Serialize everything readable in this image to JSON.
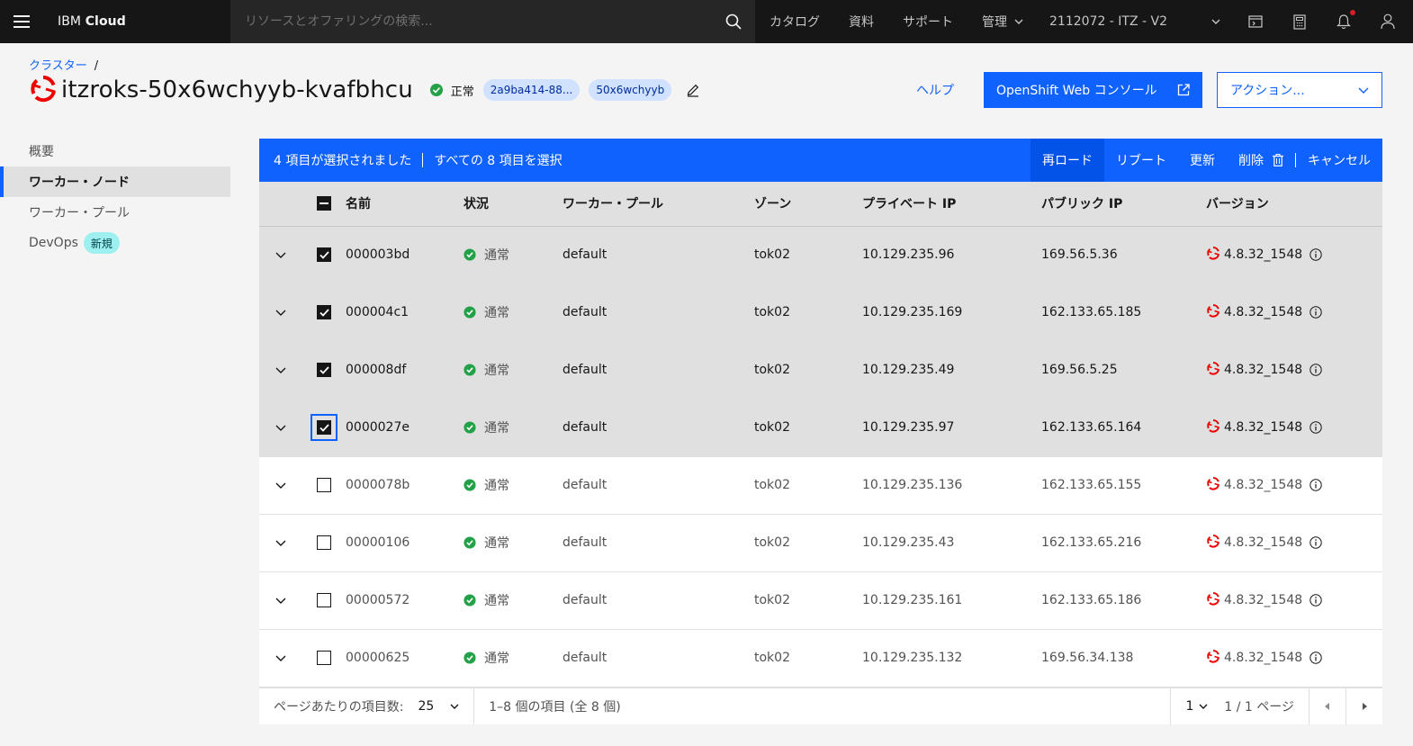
{
  "topbar": {
    "brand_prefix": "IBM",
    "brand_name": "Cloud",
    "search_placeholder": "リソースとオファリングの検索...",
    "nav": [
      "カタログ",
      "資料",
      "サポート",
      "管理"
    ],
    "account": "2112072 - ITZ - V2"
  },
  "header": {
    "breadcrumb": "クラスター",
    "breadcrumb_sep": "/",
    "cluster_name": "itzroks-50x6wchyyb-kvafbhcu",
    "status": "正常",
    "tags": [
      "2a9ba414-88...",
      "50x6wchyyb"
    ],
    "help": "ヘルプ",
    "console_button": "OpenShift Web コンソール",
    "actions_button": "アクション..."
  },
  "sidenav": {
    "items": [
      "概要",
      "ワーカー・ノード",
      "ワーカー・プール",
      "DevOps"
    ],
    "badge_new": "新規"
  },
  "batch": {
    "selected_text": "4 項目が選択されました",
    "select_all": "すべての 8 項目を選択",
    "reload": "再ロード",
    "reboot": "リブート",
    "update": "更新",
    "delete": "削除",
    "cancel": "キャンセル"
  },
  "table": {
    "headers": [
      "名前",
      "状況",
      "ワーカー・プール",
      "ゾーン",
      "プライベート IP",
      "パブリック IP",
      "バージョン"
    ],
    "rows": [
      {
        "name": "000003bd",
        "status": "通常",
        "pool": "default",
        "zone": "tok02",
        "private_ip": "10.129.235.96",
        "public_ip": "169.56.5.36",
        "version": "4.8.32_1548",
        "selected": true
      },
      {
        "name": "000004c1",
        "status": "通常",
        "pool": "default",
        "zone": "tok02",
        "private_ip": "10.129.235.169",
        "public_ip": "162.133.65.185",
        "version": "4.8.32_1548",
        "selected": true
      },
      {
        "name": "000008df",
        "status": "通常",
        "pool": "default",
        "zone": "tok02",
        "private_ip": "10.129.235.49",
        "public_ip": "169.56.5.25",
        "version": "4.8.32_1548",
        "selected": true
      },
      {
        "name": "0000027e",
        "status": "通常",
        "pool": "default",
        "zone": "tok02",
        "private_ip": "10.129.235.97",
        "public_ip": "162.133.65.164",
        "version": "4.8.32_1548",
        "selected": true
      },
      {
        "name": "0000078b",
        "status": "通常",
        "pool": "default",
        "zone": "tok02",
        "private_ip": "10.129.235.136",
        "public_ip": "162.133.65.155",
        "version": "4.8.32_1548",
        "selected": false
      },
      {
        "name": "00000106",
        "status": "通常",
        "pool": "default",
        "zone": "tok02",
        "private_ip": "10.129.235.43",
        "public_ip": "162.133.65.216",
        "version": "4.8.32_1548",
        "selected": false
      },
      {
        "name": "00000572",
        "status": "通常",
        "pool": "default",
        "zone": "tok02",
        "private_ip": "10.129.235.161",
        "public_ip": "162.133.65.186",
        "version": "4.8.32_1548",
        "selected": false
      },
      {
        "name": "00000625",
        "status": "通常",
        "pool": "default",
        "zone": "tok02",
        "private_ip": "10.129.235.132",
        "public_ip": "169.56.34.138",
        "version": "4.8.32_1548",
        "selected": false
      }
    ]
  },
  "pagination": {
    "items_per_page_label": "ページあたりの項目数:",
    "items_per_page": "25",
    "range": "1–8 個の項目 (全 8 個)",
    "page": "1",
    "page_of": "1 / 1 ページ"
  },
  "colors": {
    "primary": "#0f62fe",
    "success": "#24a148",
    "openshift_red": "#ee0000",
    "topbar": "#161616"
  }
}
